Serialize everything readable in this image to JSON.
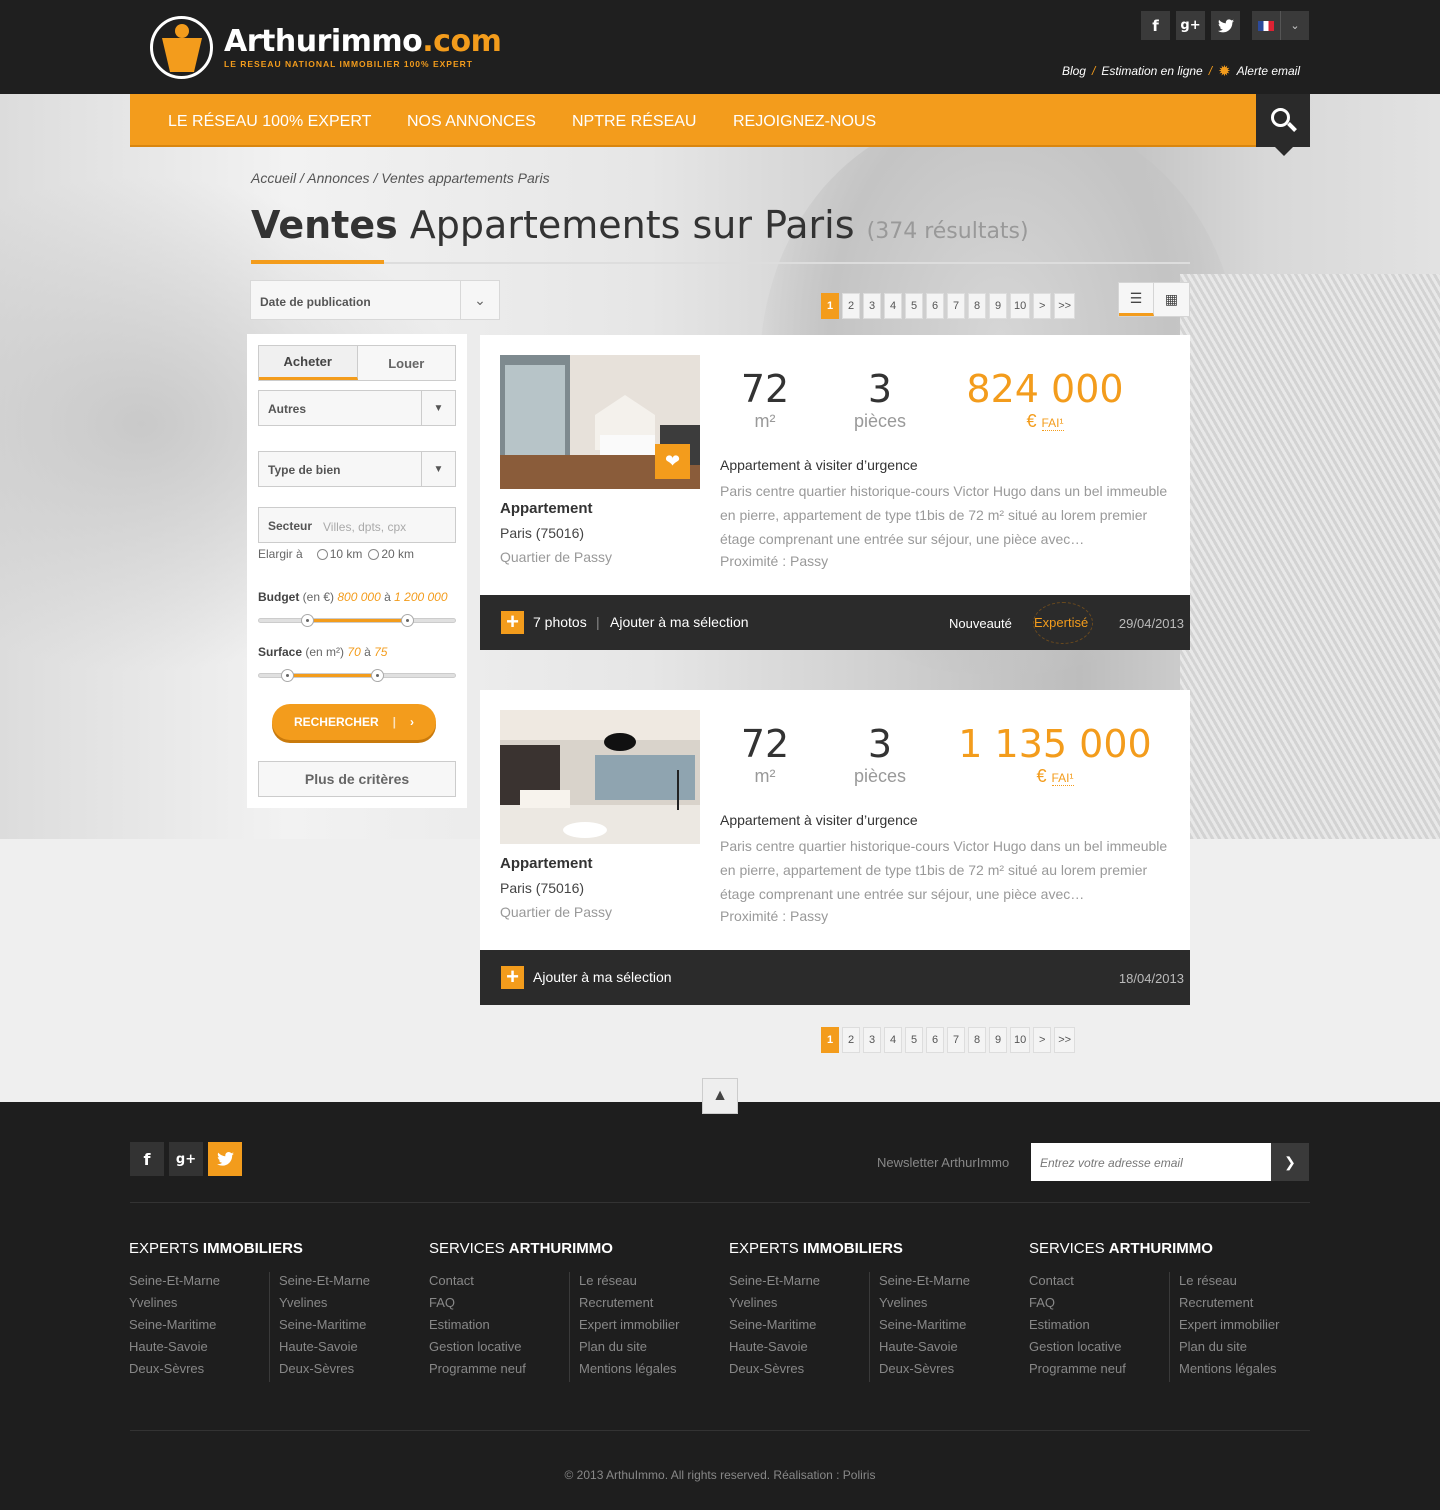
{
  "header": {
    "logo_text": "Arthurimmo",
    "logo_domain": ".com",
    "tagline": "LE RESEAU NATIONAL IMMOBILIER 100% EXPERT",
    "social": [
      "f",
      "g+",
      "twitter"
    ],
    "links": [
      "Blog",
      "Estimation en ligne",
      "Alerte email"
    ],
    "link_separator": "/"
  },
  "nav": {
    "items": [
      "LE RÉSEAU 100% EXPERT",
      "NOS ANNONCES",
      "NPTRE RÉSEAU",
      "REJOIGNEZ-NOUS"
    ],
    "search_icon": "search-icon"
  },
  "breadcrumb": "Accueil / Annonces / Ventes appartements Paris",
  "title": {
    "bold": "Ventes",
    "rest": " Appartements sur Paris",
    "count": "(374 résultats)"
  },
  "sort": {
    "label": "Date de publication"
  },
  "pagination": {
    "pages": [
      "1",
      "2",
      "3",
      "4",
      "5",
      "6",
      "7",
      "8",
      "9",
      "10",
      ">",
      ">>"
    ],
    "active": "1"
  },
  "sidebar": {
    "tabs": [
      "Acheter",
      "Louer"
    ],
    "select1": "Autres",
    "select2": "Type de bien",
    "sector_label": "Secteur",
    "sector_placeholder": "Villes, dpts, cpx",
    "enlarge": "Elargir à",
    "radius1": "10 km",
    "radius2": "20 km",
    "budget_label": "Budget",
    "budget_unit": "(en €)",
    "budget_min": "800 000",
    "budget_to": "à",
    "budget_max": "1 200 000",
    "surface_label": "Surface",
    "surface_unit": "(en m²)",
    "surface_min": "70",
    "surface_to": "à",
    "surface_max": "75",
    "search_button": "RECHERCHER",
    "more_button": "Plus de critères"
  },
  "listings": [
    {
      "surface": "72",
      "surface_unit": "m²",
      "rooms": "3",
      "rooms_unit": "pièces",
      "price": "824 000",
      "currency": "€",
      "fai": "FAI¹",
      "lead": "Appartement à visiter d’urgence",
      "desc": "Paris centre quartier historique-cours Victor Hugo dans un bel immeuble en pierre, appartement de type t1bis de 72 m² situé au lorem premier étage comprenant une entrée sur séjour, une pièce avec…",
      "prox": "Proximité : Passy",
      "type": "Appartement",
      "city": "Paris (75016)",
      "district": "Quartier de Passy",
      "photos": "7 photos",
      "add": "Ajouter à ma sélection",
      "badge_new": "Nouveauté",
      "badge_expert": "Expertisé",
      "date": "29/04/2013"
    },
    {
      "surface": "72",
      "surface_unit": "m²",
      "rooms": "3",
      "rooms_unit": "pièces",
      "price": "1 135 000",
      "currency": "€",
      "fai": "FAI¹",
      "lead": "Appartement à visiter d’urgence",
      "desc": "Paris centre quartier historique-cours Victor Hugo dans un bel immeuble en pierre, appartement de type t1bis de 72 m² situé au lorem premier étage comprenant une entrée sur séjour, une pièce avec…",
      "prox": "Proximité : Passy",
      "type": "Appartement",
      "city": "Paris (75016)",
      "district": "Quartier de Passy",
      "add": "Ajouter à ma sélection",
      "date": "18/04/2013"
    }
  ],
  "footer": {
    "newsletter_label": "Newsletter ArthurImmo",
    "newsletter_placeholder": "Entrez votre adresse email",
    "columns": [
      {
        "h1": "EXPERTS ",
        "h2": "IMMOBILIERS",
        "a": [
          "Seine-Et-Marne",
          "Yvelines",
          "Seine-Maritime",
          "Haute-Savoie",
          "Deux-Sèvres"
        ],
        "b": [
          "Seine-Et-Marne",
          "Yvelines",
          "Seine-Maritime",
          "Haute-Savoie",
          "Deux-Sèvres"
        ]
      },
      {
        "h1": "SERVICES ",
        "h2": "ARTHURIMMO",
        "a": [
          "Contact",
          "FAQ",
          "Estimation",
          "Gestion locative",
          "Programme neuf"
        ],
        "b": [
          "Le réseau",
          "Recrutement",
          "Expert immobilier",
          "Plan du site",
          "Mentions légales"
        ]
      },
      {
        "h1": "EXPERTS ",
        "h2": "IMMOBILIERS",
        "a": [
          "Seine-Et-Marne",
          "Yvelines",
          "Seine-Maritime",
          "Haute-Savoie",
          "Deux-Sèvres"
        ],
        "b": [
          "Seine-Et-Marne",
          "Yvelines",
          "Seine-Maritime",
          "Haute-Savoie",
          "Deux-Sèvres"
        ]
      },
      {
        "h1": "SERVICES ",
        "h2": "ARTHURIMMO",
        "a": [
          "Contact",
          "FAQ",
          "Estimation",
          "Gestion locative",
          "Programme neuf"
        ],
        "b": [
          "Le réseau",
          "Recrutement",
          "Expert immobilier",
          "Plan du site",
          "Mentions légales"
        ]
      }
    ],
    "copyright": "© 2013 ArthuImmo. All rights reserved. Réalisation : Poliris"
  },
  "colors": {
    "accent": "#f39c1c",
    "dark": "#1f1f1f"
  }
}
